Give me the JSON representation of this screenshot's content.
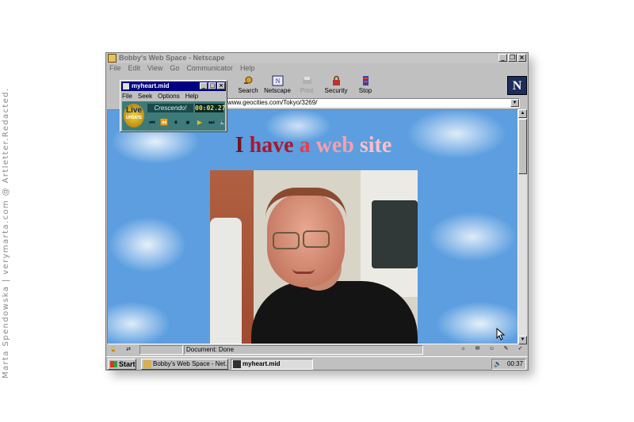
{
  "credit": "Marta Spendowska | verymarta.com @ Artletter.Redacted.",
  "browser": {
    "title": "Bobby's Web Space - Netscape",
    "menus": [
      "File",
      "Edit",
      "View",
      "Go",
      "Communicator",
      "Help"
    ],
    "toolbar": [
      {
        "label": "Search",
        "icon": "search-icon"
      },
      {
        "label": "Netscape",
        "icon": "netscape-icon"
      },
      {
        "label": "Print",
        "icon": "print-icon",
        "disabled": true
      },
      {
        "label": "Security",
        "icon": "lock-icon"
      },
      {
        "label": "Stop",
        "icon": "stop-icon"
      }
    ],
    "location": "www.geocities.com/Tokyo/3269/",
    "status": "Document: Done"
  },
  "page": {
    "headline": [
      "I ",
      "have ",
      "a ",
      "web ",
      "site"
    ]
  },
  "player": {
    "title": "myheart.mid",
    "menus": [
      "File",
      "Seek",
      "Options",
      "Help"
    ],
    "logo_text": "Live",
    "logo_sub": "UPDATE",
    "track": "Crescendo!",
    "time": "00:02.27"
  },
  "taskbar": {
    "start": "Start",
    "tasks": [
      "Bobby's Web Space - Net...",
      "myheart.mid"
    ],
    "clock": "00:37"
  }
}
